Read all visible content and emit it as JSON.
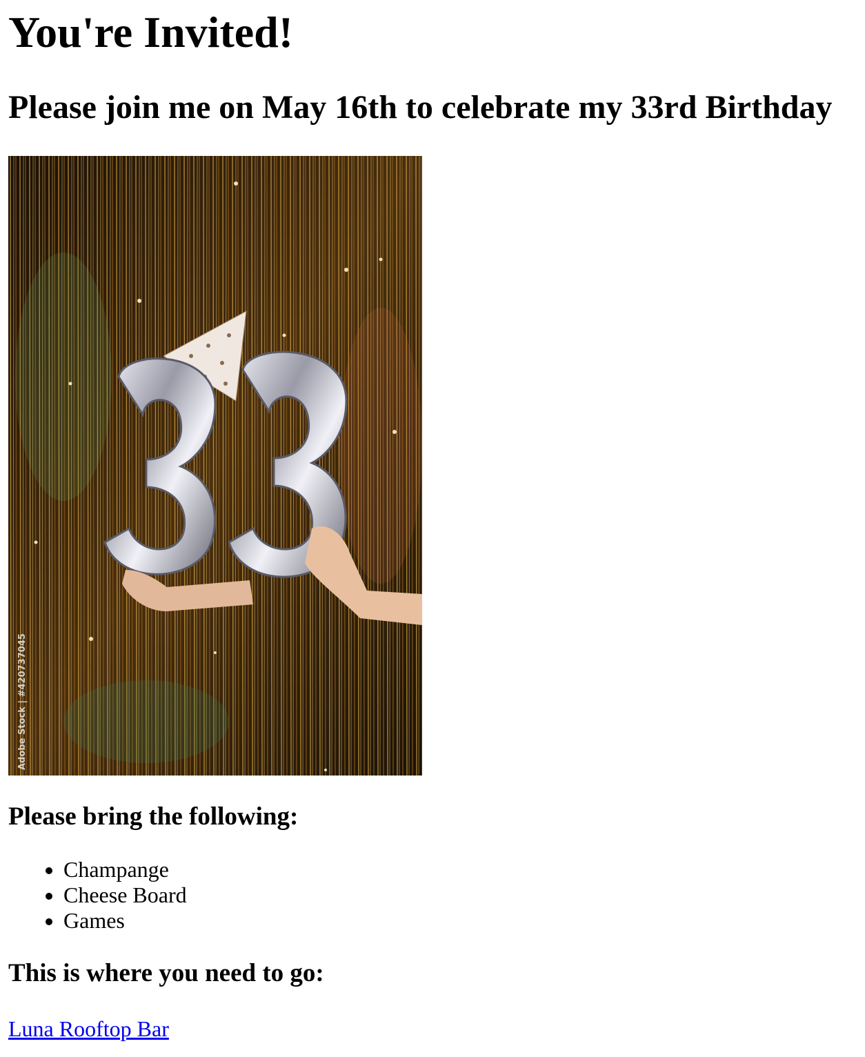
{
  "page": {
    "title": "You're Invited!",
    "subtitle": "Please join me on May 16th to celebrate my 33rd Birthday"
  },
  "photo": {
    "description_icon": "balloons-33-photo",
    "watermark": "Adobe Stock | #420737045",
    "colors": {
      "background_dark": "#2a1a08",
      "tinsel_gold": "#e0b04a",
      "balloon_silver": "#d8d8e0"
    }
  },
  "bring": {
    "heading": "Please bring the following:",
    "items": [
      "Champange",
      "Cheese Board",
      "Games"
    ]
  },
  "location": {
    "heading": "This is where you need to go:",
    "link_text": "Luna Rooftop Bar"
  },
  "colors": {
    "link": "#0000ee"
  }
}
